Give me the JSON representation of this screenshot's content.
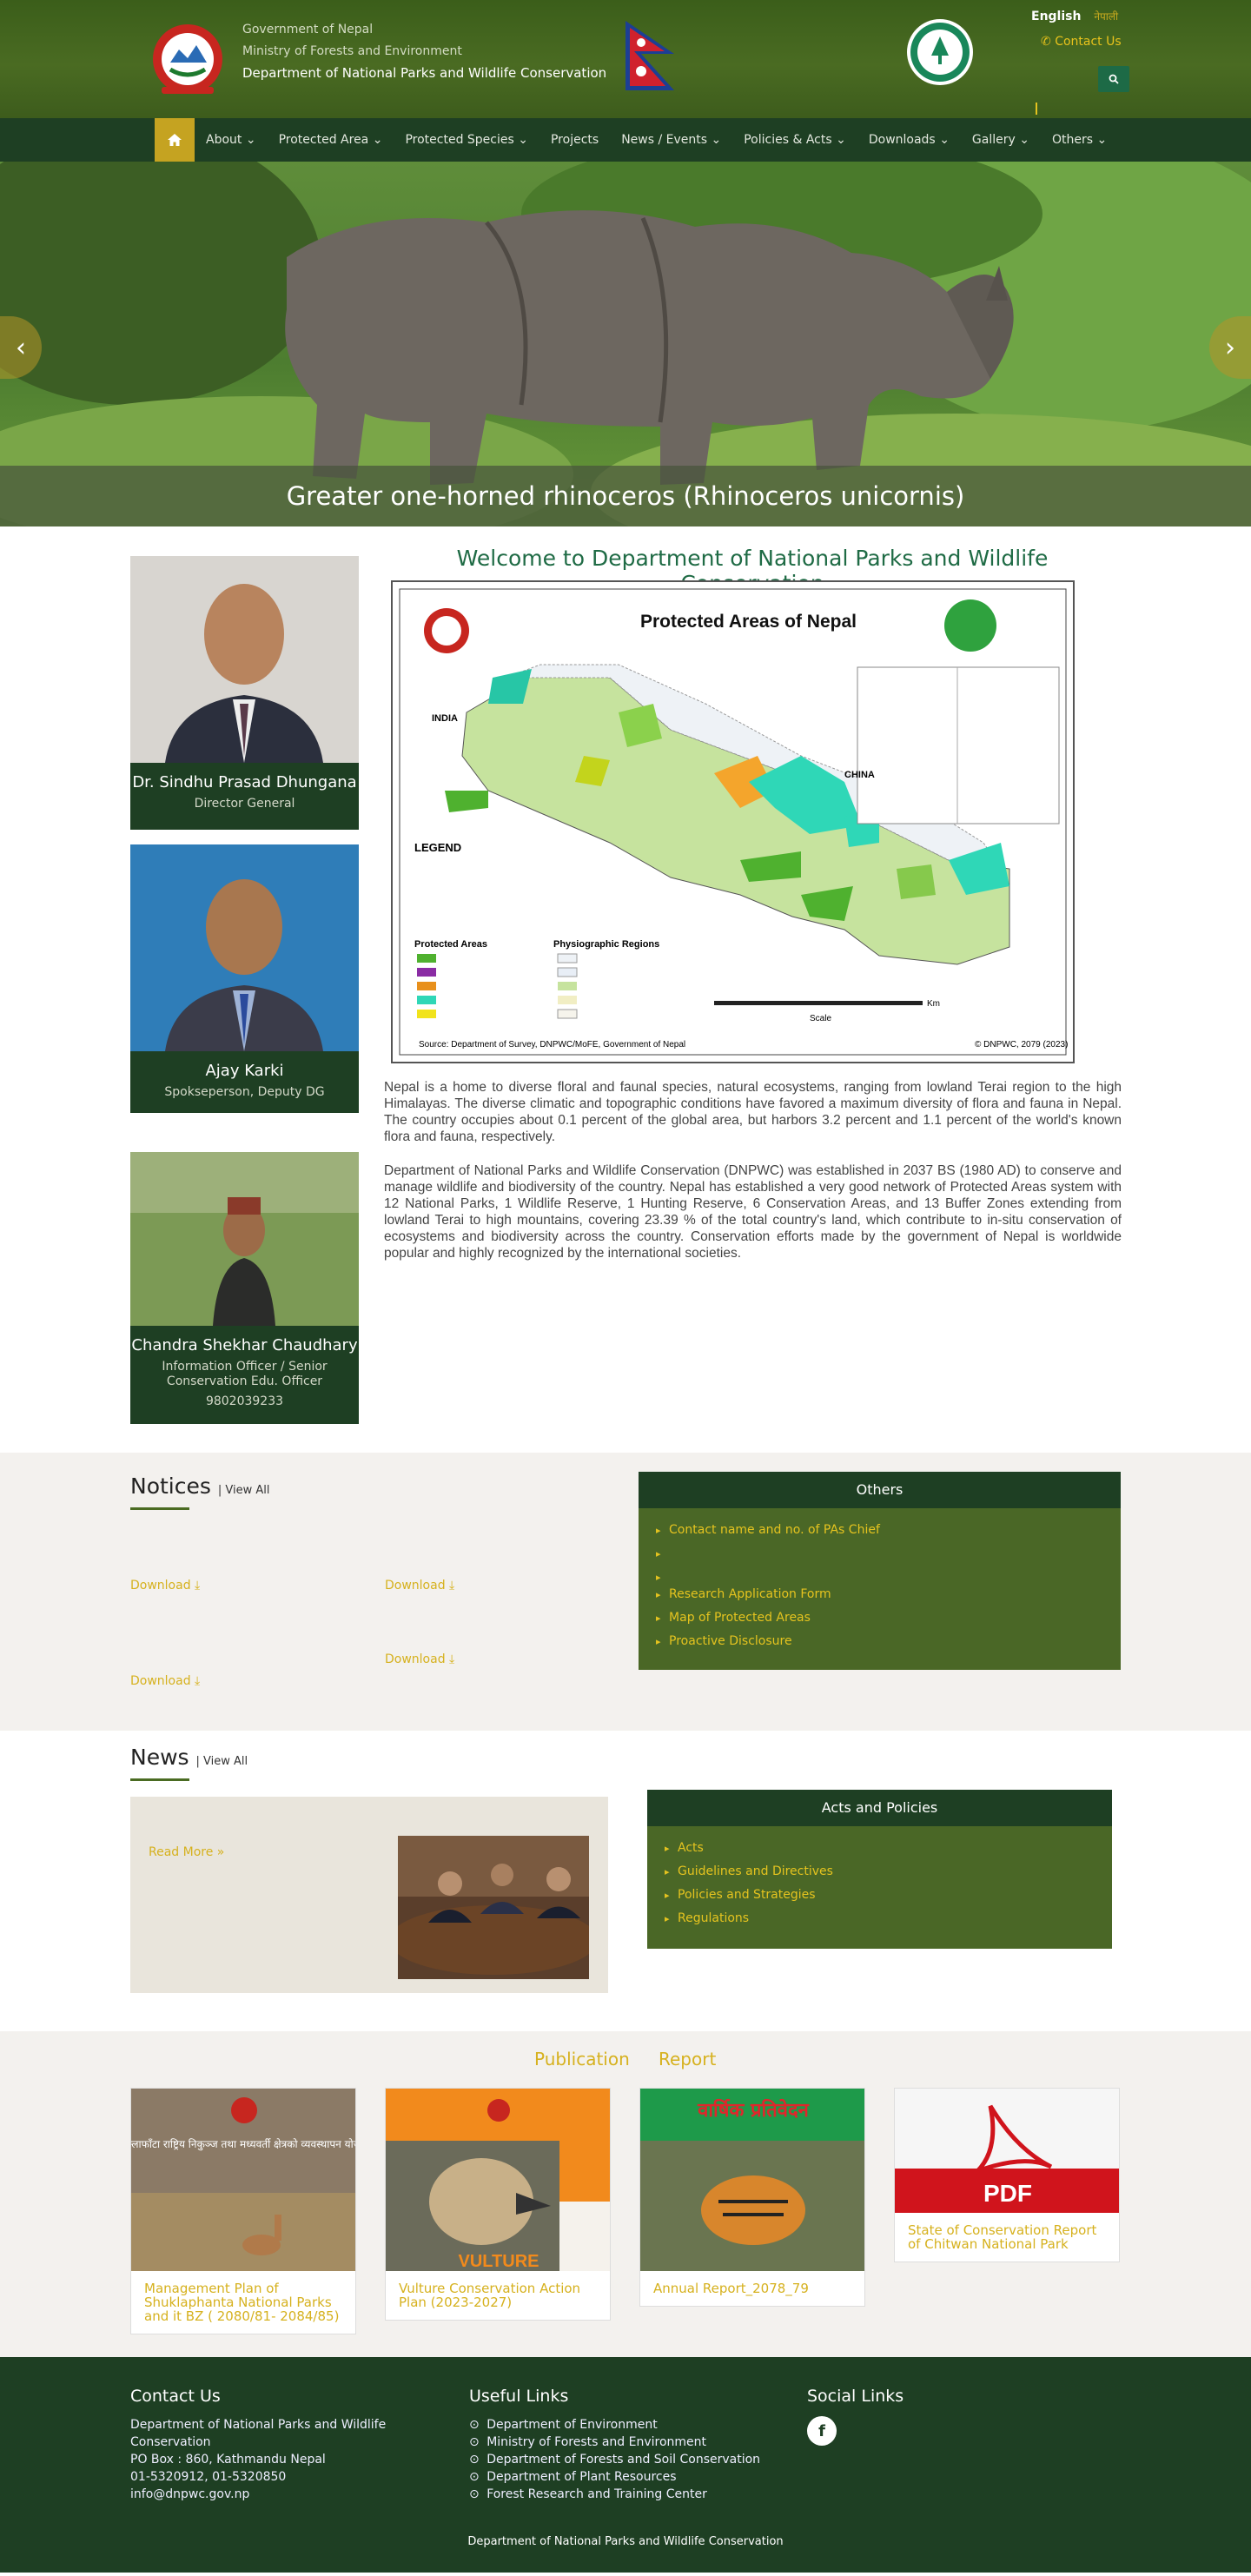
{
  "header": {
    "gov_line1": "Government of Nepal",
    "gov_line2": "Ministry of Forests and Environment",
    "gov_line3": "Department of National Parks and Wildlife Conservation",
    "lang_english": "English",
    "lang_nepali": "नेपाली",
    "contact_label": "Contact Us"
  },
  "nav": {
    "items": [
      "About",
      "Protected Area",
      "Protected Species",
      "Projects",
      "News / Events",
      "Policies & Acts",
      "Downloads",
      "Gallery",
      "Others"
    ]
  },
  "slider": {
    "caption": "Greater one-horned rhinoceros (Rhinoceros unicornis)"
  },
  "staff": [
    {
      "name": "Dr. Sindhu Prasad Dhungana",
      "role": "Director General",
      "phone": ""
    },
    {
      "name": "Ajay Karki",
      "role": "Spokseperson, Deputy DG",
      "phone": ""
    },
    {
      "name": "Chandra Shekhar Chaudhary",
      "role": "Information Officer / Senior Conservation Edu. Officer",
      "phone": "9802039233"
    }
  ],
  "welcome": {
    "title": "Welcome to Department of National Parks and Wildlife Conservation",
    "map_title": "Protected Areas of Nepal",
    "map_source": "Source: Department of Survey, DNPWC/MoFE, Government of Nepal",
    "map_copy": "© DNPWC, 2079 (2023)",
    "map_labels": {
      "china": "CHINA",
      "india": "INDIA",
      "legend": "LEGEND",
      "physio": "Physiographic Regions",
      "pa": "Protected Areas",
      "scale": "Scale",
      "km": "Km"
    },
    "para1": "Nepal is a home to diverse floral and faunal species, natural ecosystems, ranging from lowland Terai region to the high Himalayas. The diverse climatic and topographic conditions have favored a maximum diversity of flora and fauna in Nepal. The country occupies about 0.1 percent of the global area, but harbors 3.2 percent and 1.1 percent of the world's known flora and fauna, respectively.",
    "para2": "Department of National Parks and Wildlife Conservation (DNPWC) was established in 2037 BS (1980 AD) to conserve and manage wildlife and biodiversity of the country. Nepal has established a very good network of Protected Areas system with 12 National Parks, 1 Wildlife Reserve, 1 Hunting Reserve, 6 Conservation Areas, and 13 Buffer Zones extending from lowland Terai to high mountains, covering 23.39 % of the total country's land, which contribute to in-situ conservation of ecosystems and biodiversity across the country. Conservation efforts made by the government of Nepal is worldwide popular and highly recognized by the international societies."
  },
  "notices": {
    "title": "Notices",
    "view_all": "View All",
    "download": "Download"
  },
  "others_panel": {
    "title": "Others",
    "items": [
      "Contact name and no. of PAs Chief",
      "",
      "Research Application Form",
      "Map of Protected Areas",
      "Proactive Disclosure"
    ]
  },
  "news": {
    "title": "News",
    "view_all": "View All",
    "read_more": "Read More »"
  },
  "acts_panel": {
    "title": "Acts and Policies",
    "items": [
      "Acts",
      "Guidelines and Directives",
      "Policies and Strategies",
      "Regulations"
    ]
  },
  "publication": {
    "tab1": "Publication",
    "tab2": "Report",
    "cards": [
      {
        "title": "Management Plan of Shuklaphanta National Parks and it BZ ( 2080/81- 2084/85)",
        "cover_text": "शुक्लाफाँटा राष्ट्रिय निकुञ्ज तथा मध्यवर्ती क्षेत्रको व्यवस्थापन योजना"
      },
      {
        "title": "Vulture Conservation Action Plan (2023-2027)",
        "cover_text": "VULTURE"
      },
      {
        "title": "Annual Report_2078_79",
        "cover_text": "वार्षिक प्रतिवेदन"
      },
      {
        "title": "State of Conservation Report of Chitwan National Park",
        "cover_text": "PDF"
      }
    ]
  },
  "footer": {
    "contact_title": "Contact Us",
    "contact_lines": [
      "Department of National Parks and Wildlife",
      "Conservation",
      "PO Box : 860, Kathmandu Nepal",
      "01-5320912, 01-5320850",
      "info@dnpwc.gov.np"
    ],
    "useful_title": "Useful Links",
    "useful_links": [
      "Department of Environment",
      "Ministry of Forests and Environment",
      "Department of Forests and Soil Conservation",
      "Department of Plant Resources",
      "Forest Research and Training Center"
    ],
    "social_title": "Social Links",
    "copyright": "Department of National Parks and Wildlife Conservation"
  },
  "colors": {
    "primary": "#1e3f23",
    "header": "#4a6b22",
    "accent": "#d6b11e",
    "title_green": "#1f6b45"
  }
}
